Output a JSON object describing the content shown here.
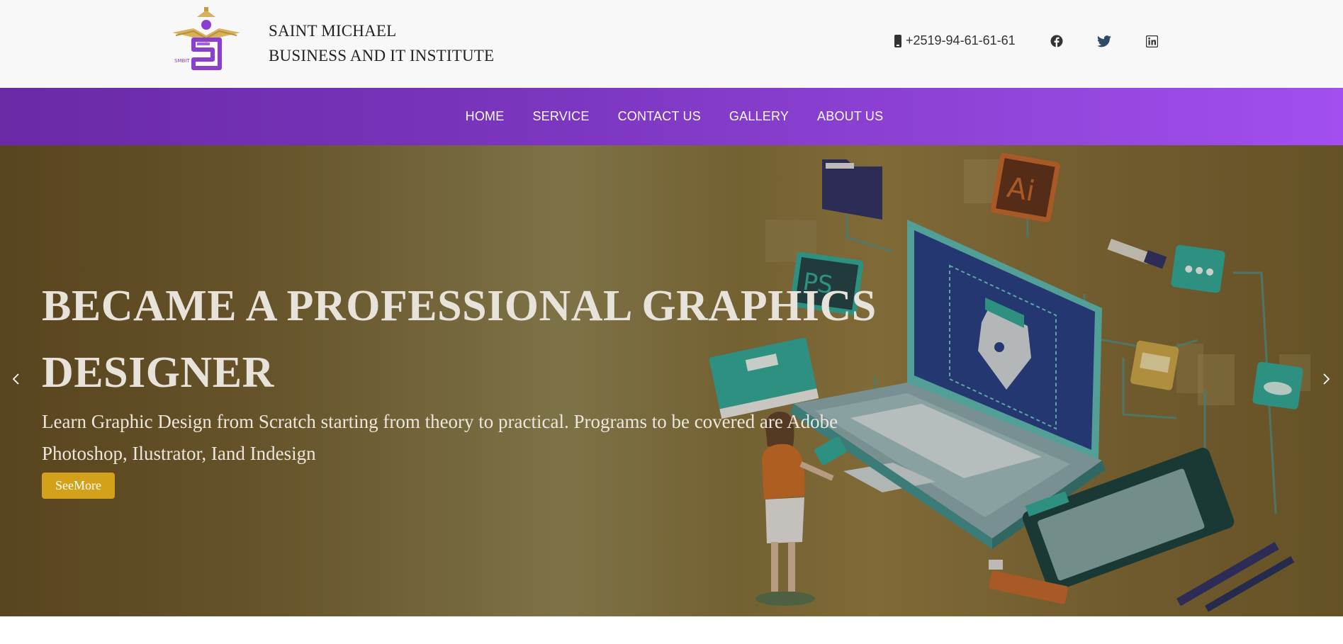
{
  "header": {
    "brand_line1": "SAINT MICHAEL",
    "brand_line2": "BUSINESS AND IT INSTITUTE",
    "phone": "+2519-94-61-61-61",
    "social": [
      "facebook-icon",
      "twitter-icon",
      "linkedin-icon"
    ]
  },
  "nav": {
    "items": [
      {
        "label": "HOME"
      },
      {
        "label": "SERVICE"
      },
      {
        "label": "CONTACT US"
      },
      {
        "label": "GALLERY"
      },
      {
        "label": "ABOUT US"
      }
    ]
  },
  "hero": {
    "title": "BECAME A PROFESSIONAL GRAPHICS DESIGNER",
    "description": "Learn Graphic Design from Scratch starting from theory to practical. Programs to be covered are Adobe Photoshop, Ilustrator, Iand Indesign",
    "button_label": "SeeMore",
    "illustration_labels": {
      "ai": "Ai",
      "ps": "PS"
    }
  },
  "colors": {
    "nav_gradient_start": "#6a2aa6",
    "nav_gradient_end": "#a24ef0",
    "button": "#d4a21a",
    "hero_text": "#e7e2da"
  }
}
